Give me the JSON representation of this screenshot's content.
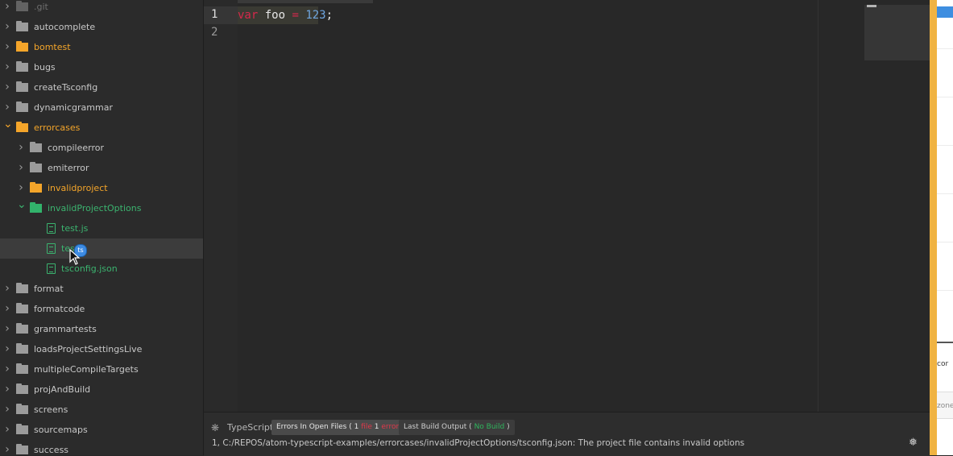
{
  "tree": {
    "items": [
      {
        "label": ".git",
        "depth": 0,
        "type": "folder",
        "state": "collapsed",
        "color": "dim"
      },
      {
        "label": "autocomplete",
        "depth": 0,
        "type": "folder",
        "state": "collapsed",
        "color": "gray"
      },
      {
        "label": "bomtest",
        "depth": 0,
        "type": "folder",
        "state": "collapsed",
        "color": "orange"
      },
      {
        "label": "bugs",
        "depth": 0,
        "type": "folder",
        "state": "collapsed",
        "color": "gray"
      },
      {
        "label": "createTsconfig",
        "depth": 0,
        "type": "folder",
        "state": "collapsed",
        "color": "gray"
      },
      {
        "label": "dynamicgrammar",
        "depth": 0,
        "type": "folder",
        "state": "collapsed",
        "color": "gray"
      },
      {
        "label": "errorcases",
        "depth": 0,
        "type": "folder",
        "state": "expanded",
        "color": "orange"
      },
      {
        "label": "compileerror",
        "depth": 1,
        "type": "folder",
        "state": "collapsed",
        "color": "gray"
      },
      {
        "label": "emiterror",
        "depth": 1,
        "type": "folder",
        "state": "collapsed",
        "color": "gray"
      },
      {
        "label": "invalidproject",
        "depth": 1,
        "type": "folder",
        "state": "collapsed",
        "color": "orange"
      },
      {
        "label": "invalidProjectOptions",
        "depth": 1,
        "type": "folder",
        "state": "expanded",
        "color": "green"
      },
      {
        "label": "test.js",
        "depth": 2,
        "type": "file",
        "state": "",
        "color": "green"
      },
      {
        "label": "test.ts",
        "depth": 2,
        "type": "file",
        "state": "selected",
        "color": "green"
      },
      {
        "label": "tsconfig.json",
        "depth": 2,
        "type": "file",
        "state": "",
        "color": "green"
      },
      {
        "label": "format",
        "depth": 0,
        "type": "folder",
        "state": "collapsed",
        "color": "gray"
      },
      {
        "label": "formatcode",
        "depth": 0,
        "type": "folder",
        "state": "collapsed",
        "color": "gray"
      },
      {
        "label": "grammartests",
        "depth": 0,
        "type": "folder",
        "state": "collapsed",
        "color": "gray"
      },
      {
        "label": "loadsProjectSettingsLive",
        "depth": 0,
        "type": "folder",
        "state": "collapsed",
        "color": "gray"
      },
      {
        "label": "multipleCompileTargets",
        "depth": 0,
        "type": "folder",
        "state": "collapsed",
        "color": "gray"
      },
      {
        "label": "projAndBuild",
        "depth": 0,
        "type": "folder",
        "state": "collapsed",
        "color": "gray"
      },
      {
        "label": "screens",
        "depth": 0,
        "type": "folder",
        "state": "collapsed",
        "color": "gray"
      },
      {
        "label": "sourcemaps",
        "depth": 0,
        "type": "folder",
        "state": "collapsed",
        "color": "gray"
      },
      {
        "label": "success",
        "depth": 0,
        "type": "folder",
        "state": "collapsed",
        "color": "gray"
      }
    ],
    "cursor_badge": "ts"
  },
  "editor": {
    "line_numbers": [
      "1",
      "2"
    ],
    "code": {
      "kw": "var",
      "ident": " foo ",
      "op": "=",
      "space": " ",
      "num": "123",
      "end": ";"
    }
  },
  "panel": {
    "title": "TypeScript",
    "errors_tab": {
      "prefix": "Errors In Open Files ( ",
      "files_count": "1",
      "files_word": " file ",
      "errors_count": "1",
      "errors_word": " error",
      "suffix": " )"
    },
    "build_tab": {
      "prefix": "Last Build Output ( ",
      "status": "No Build",
      "suffix": " )"
    },
    "message": "1, C:/REPOS/atom-typescript-examples/errorcases/invalidProjectOptions/tsconfig.json: The project file contains invalid options"
  },
  "other_window": {
    "text1": "cor",
    "text2": "zone"
  },
  "colors": {
    "orange": "#f4a52a",
    "green": "#3bb36f",
    "error_red": "#e0384a",
    "keyword": "#d6284c",
    "number": "#6fa6e0",
    "window_border": "#f0b342"
  },
  "icons": [
    "chevron-right-icon",
    "chevron-down-icon",
    "folder-icon",
    "file-text-icon",
    "bug-icon",
    "settings-icon"
  ]
}
